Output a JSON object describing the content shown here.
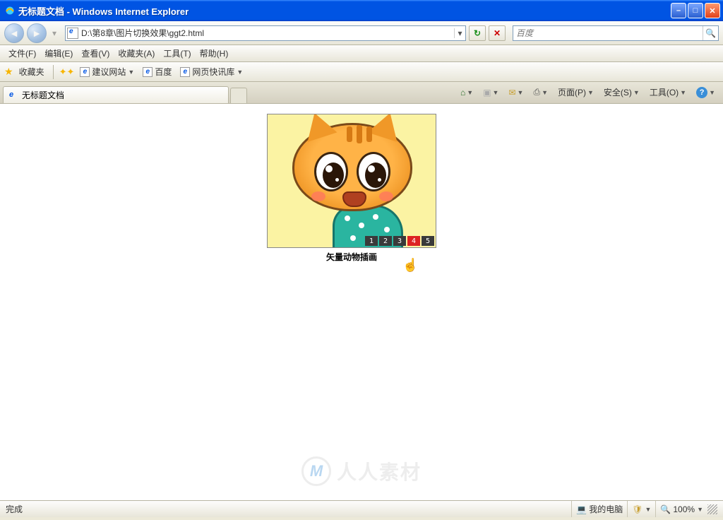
{
  "window": {
    "title": "无标题文档 - Windows Internet Explorer"
  },
  "nav": {
    "address": "D:\\第8章\\图片切换效果\\ggt2.html",
    "search_placeholder": "百度"
  },
  "menu": {
    "file": "文件(F)",
    "edit": "编辑(E)",
    "view": "查看(V)",
    "favorites": "收藏夹(A)",
    "tools": "工具(T)",
    "help": "帮助(H)"
  },
  "favbar": {
    "favorites": "收藏夹",
    "suggested": "建议网站",
    "baidu": "百度",
    "webslice": "网页快讯库"
  },
  "tab": {
    "title": "无标题文档"
  },
  "commandbar": {
    "page": "页面(P)",
    "safety": "安全(S)",
    "tools": "工具(O)"
  },
  "slideshow": {
    "caption": "矢量动物插画",
    "pages": [
      "1",
      "2",
      "3",
      "4",
      "5"
    ],
    "active_index": 3
  },
  "watermark": {
    "logo": "M",
    "text": "人人素材"
  },
  "status": {
    "done": "完成",
    "zone": "我的电脑",
    "zoom": "100%"
  }
}
